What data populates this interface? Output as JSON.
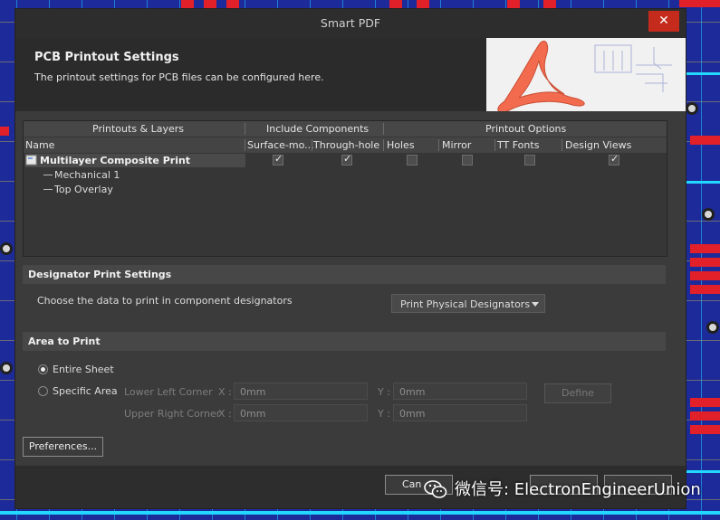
{
  "window": {
    "title": "Smart PDF",
    "close_glyph": "✕"
  },
  "header": {
    "title": "PCB Printout Settings",
    "subtitle": "The printout settings for PCB files can be configured here."
  },
  "grid": {
    "group_headers": [
      "Printouts & Layers",
      "Include Components",
      "Printout Options"
    ],
    "columns": [
      "Name",
      "Surface-mo...",
      "Through-hole",
      "Holes",
      "Mirror",
      "TT Fonts",
      "Design Views"
    ],
    "rows": [
      {
        "name": "Multilayer Composite Print",
        "checks": [
          true,
          true,
          false,
          false,
          false,
          true
        ]
      },
      {
        "name": "Mechanical 1"
      },
      {
        "name": "Top Overlay"
      }
    ]
  },
  "designator": {
    "title": "Designator Print Settings",
    "label": "Choose the data to print in component designators",
    "selected": "Print Physical Designators"
  },
  "area": {
    "title": "Area to Print",
    "entire_sheet": "Entire Sheet",
    "specific_area": "Specific Area",
    "lower_left": "Lower Left Corner",
    "upper_right": "Upper Right Corner",
    "x_label": "X :",
    "y_label": "Y :",
    "ll_x": "0mm",
    "ll_y": "0mm",
    "ur_x": "0mm",
    "ur_y": "0mm",
    "define": "Define"
  },
  "buttons": {
    "preferences": "Preferences...",
    "cancel": "Can"
  },
  "watermark": "微信号: ElectronEngineerUnion",
  "colors": {
    "accent_close": "#c42b1c",
    "dialog_bg": "#3b3b3b",
    "pdf_logo": "#f26b4e"
  }
}
